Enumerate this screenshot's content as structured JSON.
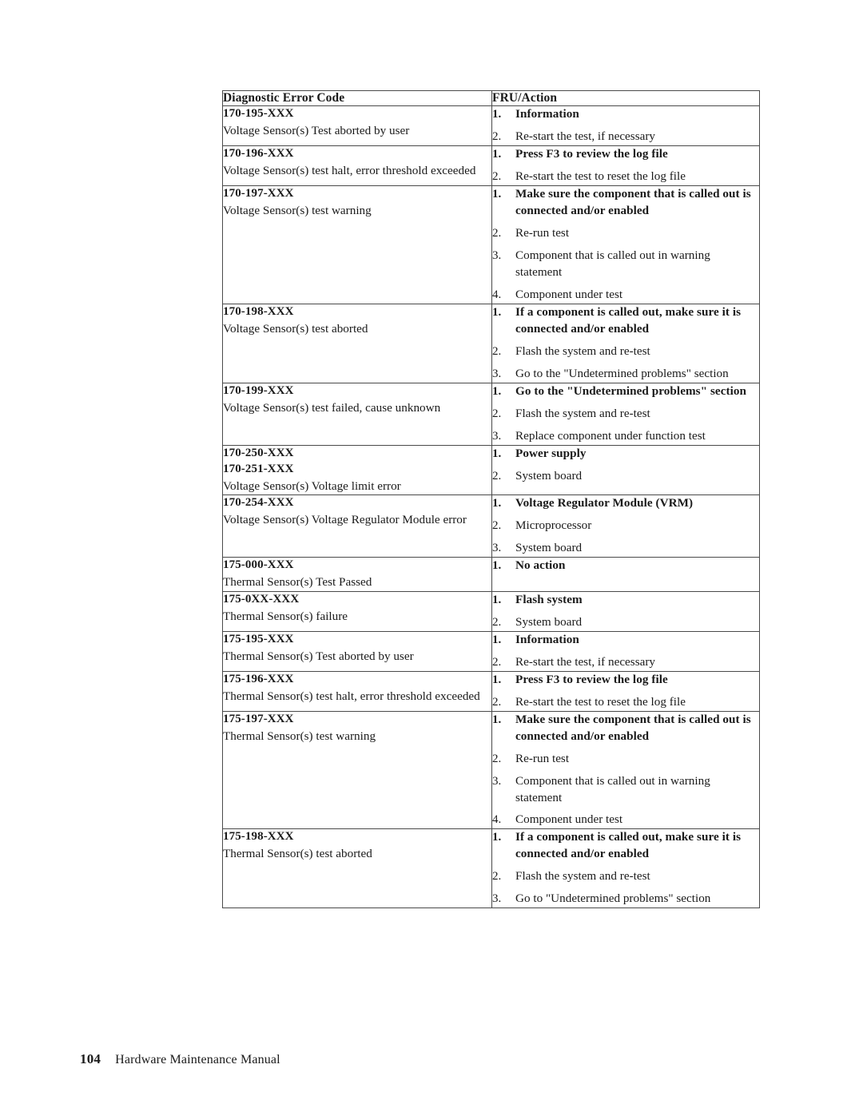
{
  "document": {
    "footer": {
      "page_number": "104",
      "manual_title": "Hardware Maintenance Manual"
    }
  },
  "table": {
    "headers": {
      "code": "Diagnostic Error Code",
      "action": "FRU/Action"
    },
    "rows": [
      {
        "codes": [
          "170-195-XXX"
        ],
        "description": "Voltage Sensor(s) Test aborted by user",
        "actions": [
          {
            "n": "1.",
            "text": "Information",
            "bold": true
          },
          {
            "n": "2.",
            "text": "Re-start the test, if necessary",
            "bold": false
          }
        ]
      },
      {
        "codes": [
          "170-196-XXX"
        ],
        "description": "Voltage Sensor(s) test halt, error threshold exceeded",
        "actions": [
          {
            "n": "1.",
            "text": "Press F3 to review the log file",
            "bold": true
          },
          {
            "n": "2.",
            "text": "Re-start the test to reset the log file",
            "bold": false
          }
        ]
      },
      {
        "codes": [
          "170-197-XXX"
        ],
        "description": "Voltage Sensor(s) test warning",
        "actions": [
          {
            "n": "1.",
            "text": "Make sure the component that is called out is connected and/or enabled",
            "bold": true
          },
          {
            "n": "2.",
            "text": "Re-run test",
            "bold": false
          },
          {
            "n": "3.",
            "text": "Component that is called out in warning statement",
            "bold": false
          },
          {
            "n": "4.",
            "text": "Component under test",
            "bold": false
          }
        ]
      },
      {
        "codes": [
          "170-198-XXX"
        ],
        "description": "Voltage Sensor(s) test aborted",
        "actions": [
          {
            "n": "1.",
            "text": "If a component is called out, make sure it is connected and/or enabled",
            "bold": true
          },
          {
            "n": "2.",
            "text": "Flash the system and re-test",
            "bold": false
          },
          {
            "n": "3.",
            "text": "Go to the \"Undetermined problems\" section",
            "bold": false
          }
        ]
      },
      {
        "codes": [
          "170-199-XXX"
        ],
        "description": "Voltage Sensor(s) test failed, cause unknown",
        "actions": [
          {
            "n": "1.",
            "text": "Go to the \"Undetermined problems\" section",
            "bold": true
          },
          {
            "n": "2.",
            "text": "Flash the system and re-test",
            "bold": false
          },
          {
            "n": "3.",
            "text": "Replace component under function test",
            "bold": false
          }
        ]
      },
      {
        "codes": [
          "170-250-XXX",
          "170-251-XXX"
        ],
        "description": "Voltage Sensor(s) Voltage limit error",
        "actions": [
          {
            "n": "1.",
            "text": "Power supply",
            "bold": true
          },
          {
            "n": "2.",
            "text": "System board",
            "bold": false
          }
        ]
      },
      {
        "codes": [
          "170-254-XXX"
        ],
        "description": "Voltage Sensor(s) Voltage Regulator Module error",
        "actions": [
          {
            "n": "1.",
            "text": "Voltage Regulator Module (VRM)",
            "bold": true
          },
          {
            "n": "2.",
            "text": "Microprocessor",
            "bold": false
          },
          {
            "n": "3.",
            "text": "System board",
            "bold": false
          }
        ]
      },
      {
        "codes": [
          "175-000-XXX"
        ],
        "description": "Thermal Sensor(s) Test Passed",
        "actions": [
          {
            "n": "1.",
            "text": "No action",
            "bold": true
          }
        ]
      },
      {
        "codes": [
          "175-0XX-XXX"
        ],
        "description": "Thermal Sensor(s) failure",
        "actions": [
          {
            "n": "1.",
            "text": "Flash system",
            "bold": true
          },
          {
            "n": "2.",
            "text": "System board",
            "bold": false
          }
        ]
      },
      {
        "codes": [
          "175-195-XXX"
        ],
        "description": "Thermal Sensor(s) Test aborted by user",
        "actions": [
          {
            "n": "1.",
            "text": "Information",
            "bold": true
          },
          {
            "n": "2.",
            "text": "Re-start the test, if necessary",
            "bold": false
          }
        ]
      },
      {
        "codes": [
          "175-196-XXX"
        ],
        "description": "Thermal Sensor(s) test halt, error threshold exceeded",
        "actions": [
          {
            "n": "1.",
            "text": "Press F3 to review the log file",
            "bold": true
          },
          {
            "n": "2.",
            "text": "Re-start the test to reset the log file",
            "bold": false
          }
        ]
      },
      {
        "codes": [
          "175-197-XXX"
        ],
        "description": "Thermal Sensor(s) test warning",
        "actions": [
          {
            "n": "1.",
            "text": "Make sure the component that is called out is connected and/or enabled",
            "bold": true
          },
          {
            "n": "2.",
            "text": "Re-run test",
            "bold": false
          },
          {
            "n": "3.",
            "text": "Component that is called out in warning statement",
            "bold": false
          },
          {
            "n": "4.",
            "text": "Component under test",
            "bold": false
          }
        ]
      },
      {
        "codes": [
          "175-198-XXX"
        ],
        "description": "Thermal Sensor(s) test aborted",
        "actions": [
          {
            "n": "1.",
            "text": "If a component is called out, make sure it is connected and/or enabled",
            "bold": true
          },
          {
            "n": "2.",
            "text": "Flash the system and re-test",
            "bold": false
          },
          {
            "n": "3.",
            "text": "Go to \"Undetermined problems\" section",
            "bold": false
          }
        ]
      }
    ]
  }
}
